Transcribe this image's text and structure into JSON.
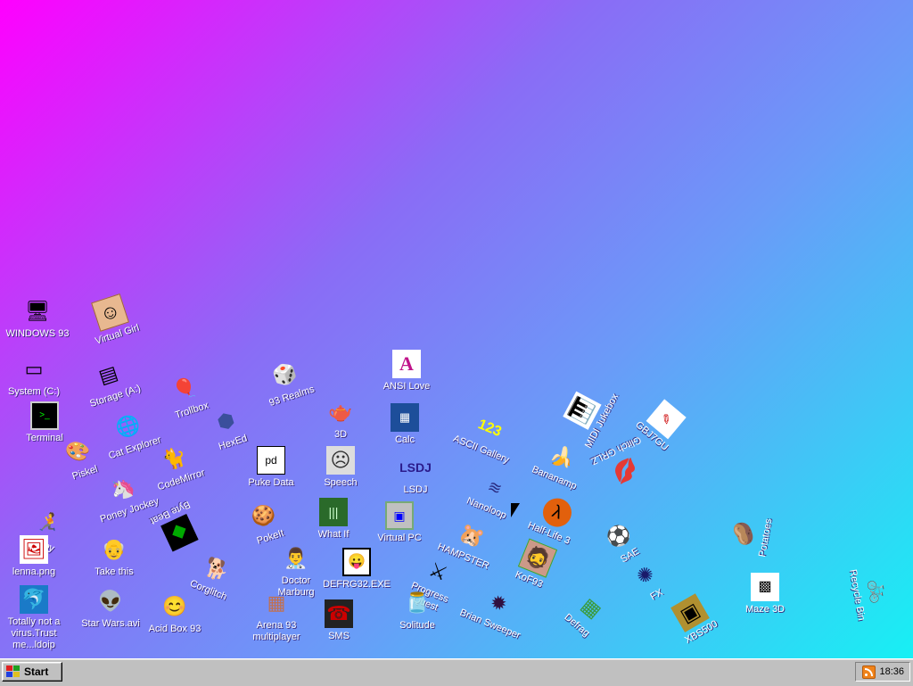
{
  "desktop": {
    "background_colors": [
      "#ff00ff",
      "#8a6cf6",
      "#6a9bf8",
      "#17f0f4"
    ],
    "icons": [
      {
        "label": "WINDOWS 93",
        "icon": "computer-icon"
      },
      {
        "label": "Virtual Girl",
        "icon": "portrait-icon"
      },
      {
        "label": "System (C:)",
        "icon": "hard-drive-icon"
      },
      {
        "label": "Storage (A:)",
        "icon": "floppy-drive-icon"
      },
      {
        "label": "Trollbox",
        "icon": "chat-icon"
      },
      {
        "label": "93 Realms",
        "icon": "dice-icon"
      },
      {
        "label": "ANSI Love",
        "icon": "document-a-icon"
      },
      {
        "label": "Terminal",
        "icon": "terminal-icon"
      },
      {
        "label": "Cat Explorer",
        "icon": "globe-icon"
      },
      {
        "label": "HexEd",
        "icon": "hexagon-icon"
      },
      {
        "label": "3D",
        "icon": "teapot-icon"
      },
      {
        "label": "Calc",
        "icon": "calculator-icon"
      },
      {
        "label": "ASCII Gallery",
        "icon": "numbers-icon"
      },
      {
        "label": "MIDI Jukebox",
        "icon": "piano-icon"
      },
      {
        "label": "GBJ7GU",
        "icon": "document-icon"
      },
      {
        "label": "Piskel",
        "icon": "palette-icon"
      },
      {
        "label": "CodeMirror",
        "icon": "cat-icon"
      },
      {
        "label": "Puke Data",
        "icon": "floppy-note-icon"
      },
      {
        "label": "Speech",
        "icon": "face-icon"
      },
      {
        "label": "LSDJ",
        "icon": "lsdj-icon"
      },
      {
        "label": "Bananamp",
        "icon": "banana-icon"
      },
      {
        "label": "Glitch GRLZ",
        "icon": "lips-icon"
      },
      {
        "label": "Poney Jockey",
        "icon": "pony-icon"
      },
      {
        "label": "Byte Beat",
        "icon": "beat-icon"
      },
      {
        "label": "Nanoloop",
        "icon": "waves-icon"
      },
      {
        "label": "Half-Life 3",
        "icon": "lambda-icon"
      },
      {
        "label": "Robby",
        "icon": "stick-figure-icon"
      },
      {
        "label": "PokeIt",
        "icon": "cookie-icon"
      },
      {
        "label": "What If",
        "icon": "barcode-icon"
      },
      {
        "label": "Virtual PC",
        "icon": "window-icon"
      },
      {
        "label": "HAMPSTER",
        "icon": "hamster-icon"
      },
      {
        "label": "SAE",
        "icon": "ball-icon"
      },
      {
        "label": "Potatoes",
        "icon": "potato-icon"
      },
      {
        "label": "lenna.png",
        "icon": "image-file-icon"
      },
      {
        "label": "Take this",
        "icon": "character-icon"
      },
      {
        "label": "Corglitch",
        "icon": "corgi-icon"
      },
      {
        "label": "Doctor Marburg",
        "icon": "doctor-icon"
      },
      {
        "label": "DEFRG32.EXE",
        "icon": "face-window-icon"
      },
      {
        "label": "Progress Quest",
        "icon": "sword-icon"
      },
      {
        "label": "KoF93",
        "icon": "fighter-icon"
      },
      {
        "label": "FX",
        "icon": "gear-icon"
      },
      {
        "label": "Maze 3D",
        "icon": "maze-icon"
      },
      {
        "label": "Totally not a virus.Trust me...ldoip",
        "icon": "dolphin-icon"
      },
      {
        "label": "Star Wars.avi",
        "icon": "yoda-icon"
      },
      {
        "label": "Acid Box 93",
        "icon": "smiley-icon"
      },
      {
        "label": "Arena 93 multiplayer",
        "icon": "cube-icon"
      },
      {
        "label": "SMS",
        "icon": "phone-icon"
      },
      {
        "label": "Solitude",
        "icon": "jar-icon"
      },
      {
        "label": "Brian Sweeper",
        "icon": "mine-icon"
      },
      {
        "label": "Defrag",
        "icon": "blocks-icon"
      },
      {
        "label": "XBS500",
        "icon": "box-icon"
      },
      {
        "label": "Recycle Bin",
        "icon": "bike-icon"
      }
    ]
  },
  "taskbar": {
    "start_label": "Start",
    "clock": "18:36",
    "tray_icon": "rss-icon"
  }
}
